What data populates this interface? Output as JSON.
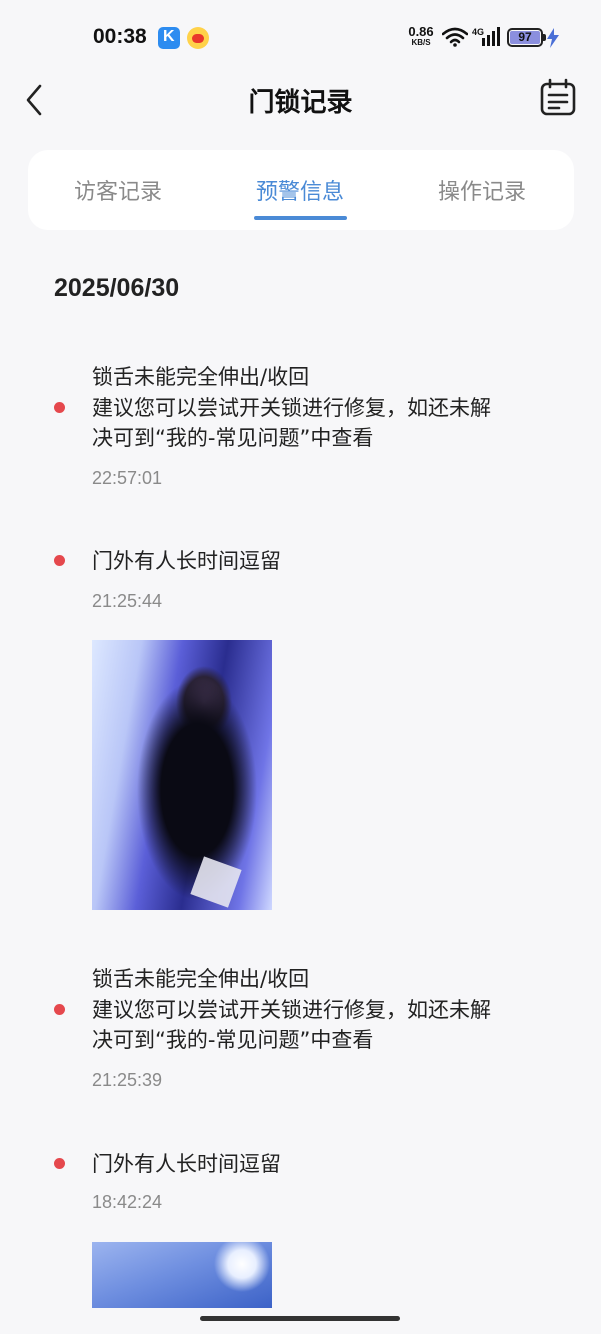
{
  "status_bar": {
    "time": "00:38",
    "net_speed_value": "0.86",
    "net_speed_unit": "KB/S",
    "cell_label": "4G",
    "battery": "97",
    "icons": [
      "k-app-icon",
      "weibo-icon",
      "wifi-icon",
      "cellular-signal-icon",
      "battery-icon",
      "charging-bolt-icon"
    ]
  },
  "header": {
    "title": "门锁记录",
    "back_icon": "chevron-left-icon",
    "calendar_icon": "calendar-icon"
  },
  "tabs": [
    {
      "label": "访客记录",
      "active": false
    },
    {
      "label": "预警信息",
      "active": true
    },
    {
      "label": "操作记录",
      "active": false
    }
  ],
  "colors": {
    "accent": "#4a8ad6",
    "alert_dot": "#e5484d",
    "background": "#f7f7f9"
  },
  "date": "2025/06/30",
  "records": [
    {
      "title": "锁舌未能完全伸出/收回",
      "detail_line1": "建议您可以尝试开关锁进行修复，如还未解",
      "detail_line2": "决可到“我的-常见问题”中查看",
      "time": "22:57:01",
      "has_image": false
    },
    {
      "title": "门外有人长时间逗留",
      "time": "21:25:44",
      "has_image": true
    },
    {
      "title": "锁舌未能完全伸出/收回",
      "detail_line1": "建议您可以尝试开关锁进行修复，如还未解",
      "detail_line2": "决可到“我的-常见问题”中查看",
      "time": "21:25:39",
      "has_image": false
    },
    {
      "title": "门外有人长时间逗留",
      "time": "18:42:24",
      "has_image": true
    }
  ]
}
